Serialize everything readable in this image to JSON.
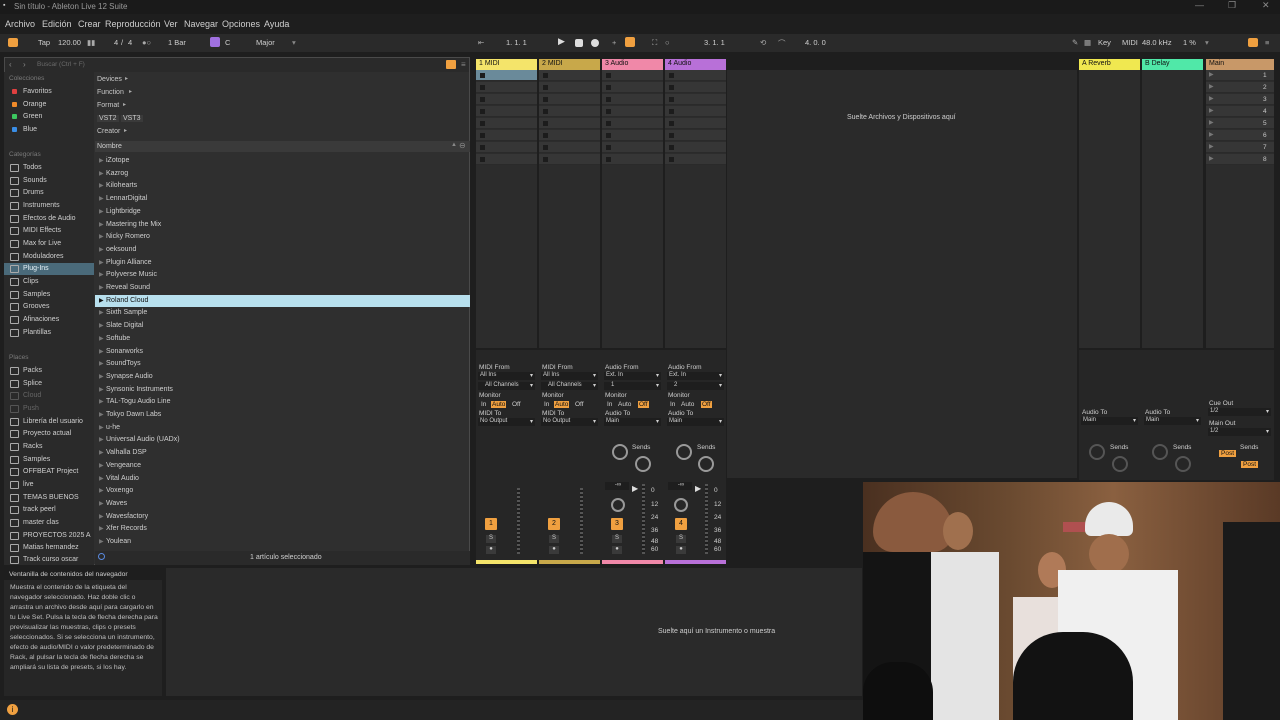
{
  "window": {
    "title": "Sin título - Ableton Live 12 Suite"
  },
  "menu": [
    "Archivo",
    "Edición",
    "Crear",
    "Reproducción",
    "Ver",
    "Navegar",
    "Opciones",
    "Ayuda"
  ],
  "control_bar": {
    "tap": "Tap",
    "tempo": "120.00",
    "sig_num": "4",
    "sig_sep": "/",
    "sig_den": "4",
    "quant": "1 Bar",
    "key": "C",
    "scale": "Major",
    "pos1": "1.  1.  1",
    "pos2": "3.  1.  1",
    "pos3": "4.  0.  0",
    "key_label": "Key",
    "midi_label": "MIDI",
    "sample_rate": "48.0 kHz",
    "cpu": "1 %"
  },
  "browser": {
    "search_placeholder": "Buscar (Ctrl + F)",
    "collections_header": "Colecciones",
    "collections": [
      {
        "label": "Favoritos",
        "color": "#e04040"
      },
      {
        "label": "Orange",
        "color": "#f08a2a"
      },
      {
        "label": "Green",
        "color": "#3cc860"
      },
      {
        "label": "Blue",
        "color": "#3a8ee6"
      }
    ],
    "categories_header": "Categorías",
    "categories": [
      "Todos",
      "Sounds",
      "Drums",
      "Instruments",
      "Efectos de Audio",
      "MIDI Effects",
      "Max for Live",
      "Moduladores",
      "Plug-Ins",
      "Clips",
      "Samples",
      "Grooves",
      "Afinaciones",
      "Plantillas"
    ],
    "places_header": "Places",
    "places": [
      "Packs",
      "Splice",
      "Cloud",
      "Push",
      "Librería del usuario",
      "Proyecto actual",
      "Racks",
      "Samples",
      "OFFBEAT Project",
      "live",
      "TEMAS BUENOS",
      "track peerl",
      "master clas",
      "PROYECTOS 2025 A",
      "Matias hernandez",
      "Track curso oscar"
    ],
    "filters": [
      "Devices",
      "Function",
      "Format",
      "Creator"
    ],
    "format_tags": [
      "VST2",
      "VST3"
    ],
    "column_header": "Nombre",
    "items": [
      "iZotope",
      "Kazrog",
      "Kilohearts",
      "LennarDigital",
      "Lightbridge",
      "Mastering the Mix",
      "Nicky Romero",
      "oeksound",
      "Plugin Alliance",
      "Polyverse Music",
      "Reveal Sound",
      "Roland Cloud",
      "Sixth Sample",
      "Slate Digital",
      "Softube",
      "Sonarworks",
      "SoundToys",
      "Synapse Audio",
      "Synsonic Instruments",
      "TAL-Togu Audio Line",
      "Tokyo Dawn Labs",
      "u-he",
      "Universal Audio (UADx)",
      "Valhalla DSP",
      "Vengeance",
      "Vital Audio",
      "Voxengo",
      "Waves",
      "Wavesfactory",
      "Xfer Records",
      "Youlean"
    ],
    "selected_item": "Roland Cloud",
    "status": "1 artículo seleccionado"
  },
  "info_panel": {
    "title": "Ventanilla de contenidos del navegador",
    "body": "Muestra el contenido de la etiqueta del navegador seleccionado. Haz doble clic o arrastra un archivo desde aquí para cargarlo en tu Live Set. Pulsa la tecla de flecha derecha para previsualizar las muestras, clips o presets seleccionados. Si se selecciona un instrumento, efecto de audio/MIDI o valor predeterminado de Rack, al pulsar la tecla de flecha derecha se ampliará su lista de presets, si los hay."
  },
  "session": {
    "drop_files": "Suelte Archivos y Dispositivos aquí",
    "drop_instrument": "Suelte aquí un Instrumento o muestra",
    "tracks": [
      {
        "name": "1 MIDI",
        "color": "#f4e46a",
        "from_label": "MIDI From",
        "from": "All Ins",
        "chan": "All Channels",
        "monitor": "Monitor",
        "to_label": "MIDI To",
        "to": "No Output",
        "num": "1"
      },
      {
        "name": "2 MIDI",
        "color": "#c8a84a",
        "from_label": "MIDI From",
        "from": "All Ins",
        "chan": "All Channels",
        "monitor": "Monitor",
        "to_label": "MIDI To",
        "to": "No Output",
        "num": "2"
      },
      {
        "name": "3 Audio",
        "color": "#f088a8",
        "from_label": "Audio From",
        "from": "Ext. In",
        "chan": "1",
        "monitor": "Monitor",
        "to_label": "Audio To",
        "to": "Main",
        "num": "3"
      },
      {
        "name": "4 Audio",
        "color": "#b870d8",
        "from_label": "Audio From",
        "from": "Ext. In",
        "chan": "2",
        "monitor": "Monitor",
        "to_label": "Audio To",
        "to": "Main",
        "num": "4"
      }
    ],
    "returns": [
      {
        "name": "A Reverb",
        "color": "#f0e850",
        "to_label": "Audio To",
        "to": "Main"
      },
      {
        "name": "B Delay",
        "color": "#50e8a8",
        "to_label": "Audio To",
        "to": "Main"
      }
    ],
    "main": {
      "name": "Main",
      "color": "#c89868",
      "cue_label": "Cue Out",
      "cue": "1/2",
      "main_label": "Main Out",
      "main_out": "1/2"
    },
    "scenes": [
      "1",
      "2",
      "3",
      "4",
      "5",
      "6",
      "7",
      "8"
    ],
    "monitor_opts": [
      "In",
      "Auto",
      "Off"
    ],
    "sends_label": "Sends",
    "post_label": "Post",
    "solo": "S",
    "volume": "-∞",
    "vol_zero": "0",
    "db_scale": [
      "12",
      "24",
      "36",
      "48",
      "60"
    ]
  }
}
